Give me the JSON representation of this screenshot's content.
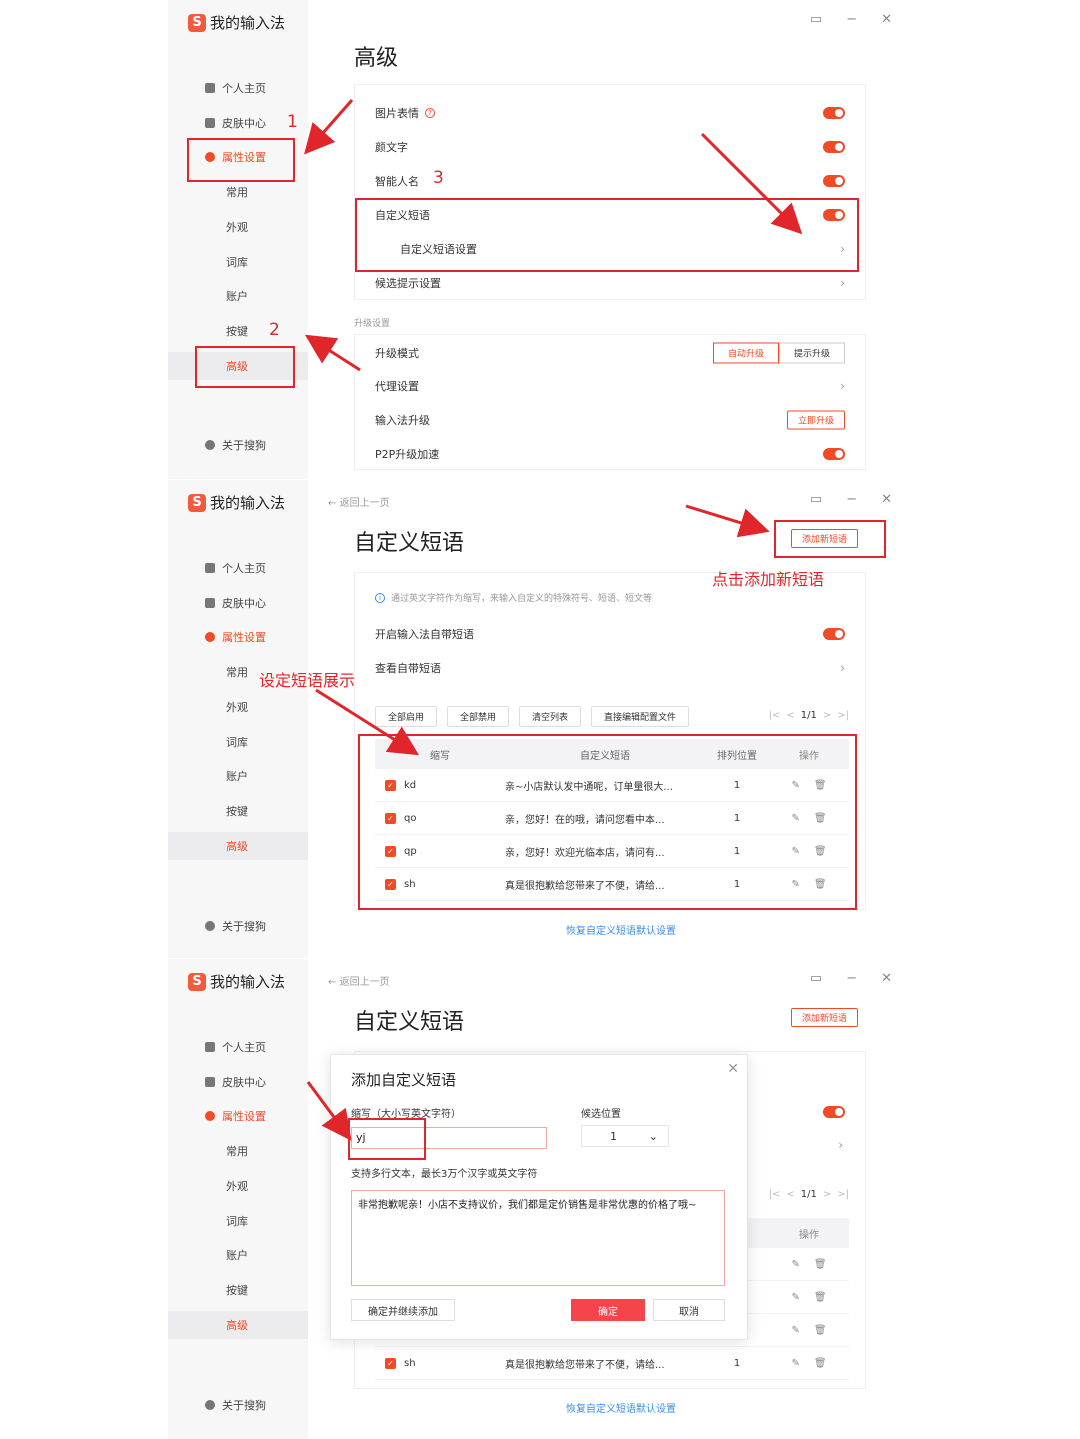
{
  "app": {
    "logo_letter": "S",
    "title": "我的输入法"
  },
  "nav": {
    "home": "个人主页",
    "skin": "皮肤中心",
    "settings": "属性设置",
    "common": "常用",
    "appearance": "外观",
    "dict": "词库",
    "account": "账户",
    "keys": "按键",
    "advanced": "高级",
    "about": "关于搜狗"
  },
  "titlebar": {
    "feedback_icon": "message-icon",
    "min": "−",
    "close": "✕"
  },
  "panel1": {
    "title": "高级",
    "rows": {
      "image_expr": "图片表情",
      "kaomoji": "颜文字",
      "smart_name": "智能人名",
      "custom_phrase": "自定义短语",
      "custom_phrase_settings": "自定义短语设置",
      "candidate_hint": "候选提示设置"
    },
    "upgrade_section": "升级设置",
    "upgrade_rows": {
      "mode": "升级模式",
      "proxy": "代理设置",
      "ime_upgrade": "输入法升级",
      "p2p": "P2P升级加速"
    },
    "mode_auto": "自动升级",
    "mode_prompt": "提示升级",
    "upgrade_now": "立即升级",
    "annotations": {
      "n1": "1",
      "n2": "2",
      "n3": "3"
    }
  },
  "panel2": {
    "back": "返回上一页",
    "title": "自定义短语",
    "add_button": "添加新短语",
    "tip": "通过英文字符作为缩写，来输入自定义的特殊符号、短语、短文等",
    "enable_builtin": "开启输入法自带短语",
    "view_builtin": "查看自带短语",
    "toolbar": [
      "全部启用",
      "全部禁用",
      "清空列表",
      "直接编辑配置文件"
    ],
    "pager": {
      "first": "|<",
      "prev": "<",
      "page": "1/1",
      "next": ">",
      "last": ">|"
    },
    "columns": [
      "缩写",
      "自定义短语",
      "排列位置",
      "操作"
    ],
    "rows": [
      {
        "abbr": "kd",
        "phrase": "亲~小店默认发中通呢，订单量很大...",
        "pos": "1"
      },
      {
        "abbr": "qo",
        "phrase": "亲，您好！在的哦，请问您看中本...",
        "pos": "1"
      },
      {
        "abbr": "qp",
        "phrase": "亲，您好！欢迎光临本店，请问有...",
        "pos": "1"
      },
      {
        "abbr": "sh",
        "phrase": "真是很抱歉给您带来了不便，请给...",
        "pos": "1"
      }
    ],
    "restore": "恢复自定义短语默认设置",
    "annotations": {
      "click_add": "点击添加新短语",
      "set_display": "设定短语展示"
    }
  },
  "panel3": {
    "back": "返回上一页",
    "title": "自定义短语",
    "add_button": "添加新短语",
    "pager": {
      "first": "|<",
      "prev": "<",
      "page": "1/1",
      "next": ">",
      "last": ">|"
    },
    "col_pos_partial": "位置",
    "col_ops": "操作",
    "last_row": {
      "abbr": "sh",
      "phrase": "真是很抱歉给您带来了不便，请给...",
      "pos": "1"
    },
    "restore": "恢复自定义短语默认设置",
    "dialog": {
      "title": "添加自定义短语",
      "abbr_label": "缩写（大小写英文字符）",
      "pos_label": "候选位置",
      "abbr_value": "yj",
      "pos_value": "1",
      "text_label": "支持多行文本，最长3万个汉字或英文字符",
      "text_value": "非常抱歉呢亲！小店不支持议价，我们都是定价销售是非常优惠的价格了哦~",
      "save_continue": "确定并继续添加",
      "ok": "确定",
      "cancel": "取消"
    }
  },
  "colors": {
    "accent": "#f04a26",
    "annotation": "#e0252b",
    "link": "#3a8cf0"
  }
}
